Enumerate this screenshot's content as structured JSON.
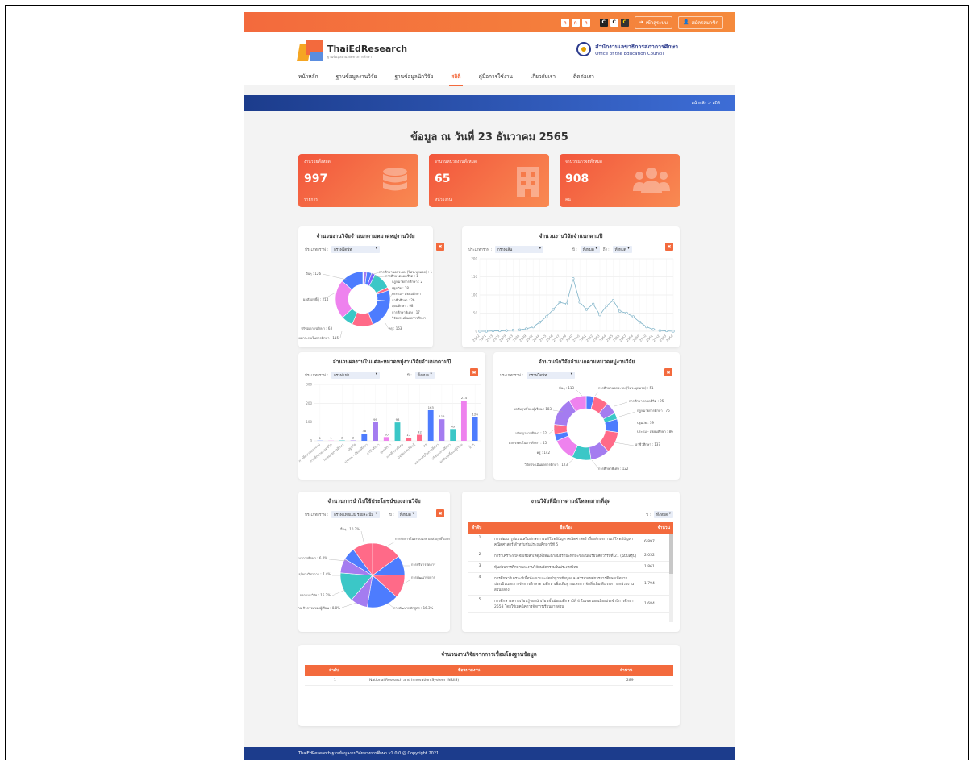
{
  "topbar": {
    "font_sizes": [
      "ก",
      "ก",
      "ก"
    ],
    "contrast": [
      "C",
      "C",
      "C"
    ],
    "login_label": "เข้าสู่ระบบ",
    "register_label": "สมัครสมาชิก"
  },
  "brand": {
    "name_thai_ed": "ThaiEd",
    "name_research": "Research",
    "tagline": "ฐานข้อมูลงานวิจัยทางการศึกษา",
    "org_th": "สำนักงานเลขาธิการสภาการศึกษา",
    "org_en": "Office of the Education Council"
  },
  "nav": {
    "items": [
      {
        "label": "หน้าหลัก",
        "active": false
      },
      {
        "label": "ฐานข้อมูลงานวิจัย",
        "active": false
      },
      {
        "label": "ฐานข้อมูลนักวิจัย",
        "active": false
      },
      {
        "label": "สถิติ",
        "active": true
      },
      {
        "label": "คู่มือการใช้งาน",
        "active": false
      },
      {
        "label": "เกี่ยวกับเรา",
        "active": false
      },
      {
        "label": "ติดต่อเรา",
        "active": false
      }
    ]
  },
  "breadcrumb": "หน้าหลัก > สถิติ",
  "date_title": "ข้อมูล ณ วันที่ 23 ธันวาคม 2565",
  "stats": [
    {
      "label": "งานวิจัยทั้งหมด",
      "value": "997",
      "unit": "รายการ",
      "icon": "database-icon"
    },
    {
      "label": "จำนวนหน่วยงานทั้งหมด",
      "value": "65",
      "unit": "หน่วยงาน",
      "icon": "building-icon"
    },
    {
      "label": "จำนวนนักวิจัยทั้งหมด",
      "value": "908",
      "unit": "คน",
      "icon": "users-icon"
    }
  ],
  "filters": {
    "type_label": "ประเภทกราฟ :",
    "year_label": "ปี :",
    "to_label": "ถึง :",
    "donut": "กราฟโดนัท",
    "line": "กราฟเส้น",
    "bar": "กราฟแท่ง",
    "bar_stack": "กราฟแท่งแบบ ร้อยละเปิ้ม",
    "all": "ทั้งหมด"
  },
  "cards": {
    "c1_title": "จำนวนงานวิจัยจำแนกตามหมวดหมู่งานวิจัย",
    "c2_title": "จำนวนงานวิจัยจำแนกตามปี",
    "c3_title": "จำนวนผลงานในแต่ละหมวดหมู่งานวิจัยจำแนกตามปี",
    "c4_title": "จำนวนนักวิจัยจำแนกตามหมวดหมู่งานวิจัย",
    "c5_title": "จำนวนการนำไปใช้ประโยชน์ของงานวิจัย",
    "c6_title": "งานวิจัยที่มีการดาวน์โหลดมากที่สุด",
    "c7_title": "จำนวนงานวิจัยจากการเชื่อมโยงฐานข้อมูล"
  },
  "chart_data": [
    {
      "type": "pie",
      "title": "จำนวนงานวิจัยจำแนกตามหมวดหมู่งานวิจัย",
      "labels": [
        "การศึกษานอกระบบ (ไม่ระบุหมวด)",
        "การศึกษาตลอดชีวิต",
        "กฎหมายการศึกษา",
        "ปฐมวัย",
        "ประถม - มัธยมศึกษา",
        "อาชีวศึกษา",
        "อุดมศึกษา",
        "การศึกษาพิเศษ",
        "ปัจจัยการเรียนรู้",
        "ครู",
        "ผลกระทบในการศึกษา",
        "ปรัชญาการศึกษา",
        "ผลสัมฤทธิ์ของผู้เรียน",
        "อื่นๆ"
      ],
      "values": [
        1,
        1,
        2,
        18,
        26,
        20,
        98,
        17,
        60,
        163,
        115,
        63,
        214,
        126
      ],
      "colors": [
        "#7b61ff",
        "#ff6a88",
        "#3bc7c7",
        "#a47cf0",
        "#4d7cfe",
        "#7b61ff",
        "#3bc7c7",
        "#ff6a88",
        "#4d7cfe",
        "#4d7cfe",
        "#ff6a88",
        "#3bc7c7",
        "#ee82ee",
        "#4d7cfe"
      ]
    },
    {
      "type": "line",
      "title": "จำนวนงานวิจัยจำแนกตามปี",
      "x": [
        "2502",
        "2521",
        "2523",
        "2525",
        "2529",
        "2533",
        "2536",
        "2539",
        "2542",
        "2544",
        "2545",
        "2546",
        "2547",
        "2548",
        "2549",
        "2550",
        "2551",
        "2552",
        "2553",
        "2554",
        "2555",
        "2556",
        "2557",
        "2558",
        "2559",
        "2560",
        "2561",
        "2562",
        "2563",
        "2564"
      ],
      "values": [
        0,
        0,
        1,
        1,
        2,
        3,
        4,
        7,
        12,
        25,
        40,
        60,
        80,
        75,
        145,
        80,
        60,
        75,
        45,
        70,
        85,
        55,
        50,
        40,
        25,
        12,
        5,
        2,
        1,
        0
      ],
      "ylim": [
        0,
        200
      ],
      "yticks": [
        0,
        50,
        100,
        150,
        200
      ]
    },
    {
      "type": "bar",
      "title": "จำนวนผลงานในแต่ละหมวดหมู่งานวิจัยจำแนกตามปี",
      "categories": [
        "การศึกษานอกระบบ",
        "การศึกษาตลอดชีวิต",
        "กฎหมายการศึกษา",
        "ปฐมวัย",
        "ประถม - มัธยมศึกษา",
        "อาชีวศึกษา",
        "อุดมศึกษา",
        "การศึกษาพิเศษ",
        "ปัจจัยการเรียนรู้",
        "ครู",
        "ผลกระทบในการศึกษา",
        "ปรัชญาการศึกษา",
        "ผลสัมฤทธิ์ของผู้เรียน",
        "อื่นๆ"
      ],
      "values": [
        1,
        1,
        2,
        2,
        38,
        99,
        20,
        98,
        17,
        32,
        163,
        115,
        63,
        214,
        126
      ],
      "labels_shown": [
        1,
        1,
        2,
        38,
        99,
        26,
        98,
        17,
        32,
        163,
        115,
        63,
        214,
        126
      ],
      "ylim": [
        0,
        300
      ],
      "yticks": [
        0,
        100,
        200,
        300
      ],
      "colors": [
        "#4d7cfe",
        "#ee82ee",
        "#3bc7c7",
        "#a47cf0",
        "#4d7cfe",
        "#a47cf0",
        "#ee82ee",
        "#3bc7c7",
        "#ff6a88",
        "#ff6a88",
        "#4d7cfe",
        "#a47cf0",
        "#3bc7c7",
        "#ee82ee",
        "#4d7cfe"
      ]
    },
    {
      "type": "pie",
      "title": "จำนวนนักวิจัยจำแนกตามหมวดหมู่งานวิจัย",
      "labels": [
        "การศึกษานอกระบบ (ไม่ระบุหมวด)",
        "การศึกษาตลอดชีวิต",
        "กฎหมายการศึกษา",
        "ปฐมวัย",
        "ประถม - มัธยมศึกษา",
        "อาชีวศึกษา",
        "การศึกษาพิเศษ",
        "วิจัยประเมินผลการศึกษา",
        "ครู",
        "ผลกระทบในการศึกษา",
        "ปรัชญาการศึกษา",
        "ผลสัมฤทธิ์ของผู้เรียน",
        "อื่นๆ"
      ],
      "values": [
        51,
        95,
        76,
        39,
        86,
        137,
        122,
        123,
        142,
        45,
        62,
        183,
        113
      ],
      "colors": [
        "#4d7cfe",
        "#ff6a88",
        "#a47cf0",
        "#3bc7c7",
        "#4d7cfe",
        "#ff6a88",
        "#a47cf0",
        "#3bc7c7",
        "#ee82ee",
        "#4d7cfe",
        "#ff6a88",
        "#a47cf0",
        "#ee82ee"
      ]
    },
    {
      "type": "pie",
      "title": "จำนวนการนำไปใช้ประโยชน์ของงานวิจัย",
      "labels": [
        "การจัดการในระบบและ ผลสัมฤทธิ์ของการวิจัย",
        "การบริหารจัดการ",
        "การพัฒนาจัดการ",
        "การพัฒนาหลักสูตร",
        "การพัฒนาผ่าน กิจกรรมของผู้เรียน",
        "ผลิตผลและ ออกแบบระบบการวิจัย",
        "นโยบายการจัดการ/ ทางวิชาการ",
        "รายงานการศึกษา/ พัฒนาการศึกษา",
        "อื่นๆ"
      ],
      "values": [
        15.2,
        10,
        12,
        16.3,
        8.8,
        15.2,
        7.4,
        6.4,
        10.3
      ],
      "colors": [
        "#ff6a88",
        "#4d7cfe",
        "#ff6a88",
        "#4d7cfe",
        "#a47cf0",
        "#3bc7c7",
        "#a47cf0",
        "#4d7cfe",
        "#ff6a88"
      ]
    }
  ],
  "c1_labels": [
    "การศึกษานอกระบบ (ไม่ระบุหมวด) : 1",
    "การศึกษาตลอดชีวิต : 1",
    "กฎหมายการศึกษา : 2",
    "ปฐมวัย : 18",
    "ประถม - มัธยมศึกษา",
    "อาชีวศึกษา : 26",
    "อุดมศึกษา : 98",
    "การศึกษาพิเศษ : 17",
    "วิจัยประเมินผลการศึกษา",
    "ครู : 163",
    "ผลกระทบในการศึกษา : 115",
    "ปรัชญาการศึกษา : 63",
    "ผลสัมฤทธิ์ผู้ : 214",
    "อื่นๆ : 126"
  ],
  "c4_labels": [
    "อื่นๆ : 113",
    "การศึกษานอกระบบ (ไม่ระบุหมวด) : 51",
    "การศึกษาตลอดชีวิต : 95",
    "กฎหมายการศึกษา : 76",
    "ปฐมวัย : 39",
    "ประถม - มัธยมศึกษา : 86",
    "อาชีวศึกษา : 137",
    "การศึกษาพิเศษ : 122",
    "วิจัยประเมินผลการศึกษา : 123",
    "ครู : 142",
    "ผลกระทบในการศึกษา : 45",
    "ปรัชญาการศึกษา : 62",
    "ผลสัมฤทธิ์ของผู้เรียน : 183"
  ],
  "c5_labels": [
    "อื่นๆ : 10.3%",
    "การจัดการในระบบและ ผลสัมฤทธิ์ของการวิจัย : 15.2%",
    "การบริหารจัดการ",
    "การพัฒนาจัดการ",
    "การพัฒนาหลักสูตร : 16.3%",
    "การพัฒนาผ่าน กิจกรรมของผู้เรียน : 8.8%",
    "ผลิตผลและ ออกแบบวิจัย : 15.2%",
    "นโยบายการจัดการ/ ทางวิชาการ : 7.4%",
    "รายงานการศึกษา/ พัฒนาการศึกษา : 6.4%"
  ],
  "downloads": {
    "headers": [
      "ลำดับ",
      "ชื่อเรื่อง",
      "จำนวน"
    ],
    "rows": [
      {
        "no": "1",
        "title": "การพัฒนารูปแบบเสริมทักษะการแก้โจทย์ปัญหาคณิตศาสตร์ เรื่องทักษะการแก้โจทย์ปัญหาคณิตศาสตร์ สำหรับชั้นประถมศึกษาปีที่ 5",
        "count": "6,897"
      },
      {
        "no": "2",
        "title": "การวิเคราะห์ปัจจัยเชิงสาเหตุเพื่อพัฒนาสมรรถนะทักษะของนักเรียนศตวรรษที่ 21 (ฉบับสรุป)",
        "count": "2,052"
      },
      {
        "no": "3",
        "title": "หุ้นส่วนการศึกษาและงานวิจัยนวัตกรรมในประเทศไทย",
        "count": "1,861"
      },
      {
        "no": "4",
        "title": "การศึกษาวิเคราะห์เพื่อพัฒนาและจัดทำฐานข้อมูลและสารสนเทศการการศึกษาเพื่อการประเมินและการจัดการศึกษาตามศึกษาเพิ่มเติมฐานและการจัดสิ่งเพิ่มเติมระหว่างหน่วยงานส่วนกลาง",
        "count": "1,794"
      },
      {
        "no": "5",
        "title": "การศึกษาผลการเรียนรู้ของนักเรียนชั้นมัธยมศึกษาปีที่ 4 ในเขตนอกเมืองประจำปีการศึกษา 2558 โดยใช้เทคนิคการจัดการเรียนการสอน",
        "count": "1,684"
      }
    ]
  },
  "linked": {
    "headers": [
      "ลำดับ",
      "ชื่อหน่วยงาน",
      "จำนวน"
    ],
    "rows": [
      {
        "no": "1",
        "name": "National Research and Innovation System (NRIIS)",
        "count": "289"
      }
    ]
  },
  "footer": "ThaiEdResearch ฐานข้อมูลงานวิจัยทางการศึกษา v1.0.0 @ Copyright 2021"
}
